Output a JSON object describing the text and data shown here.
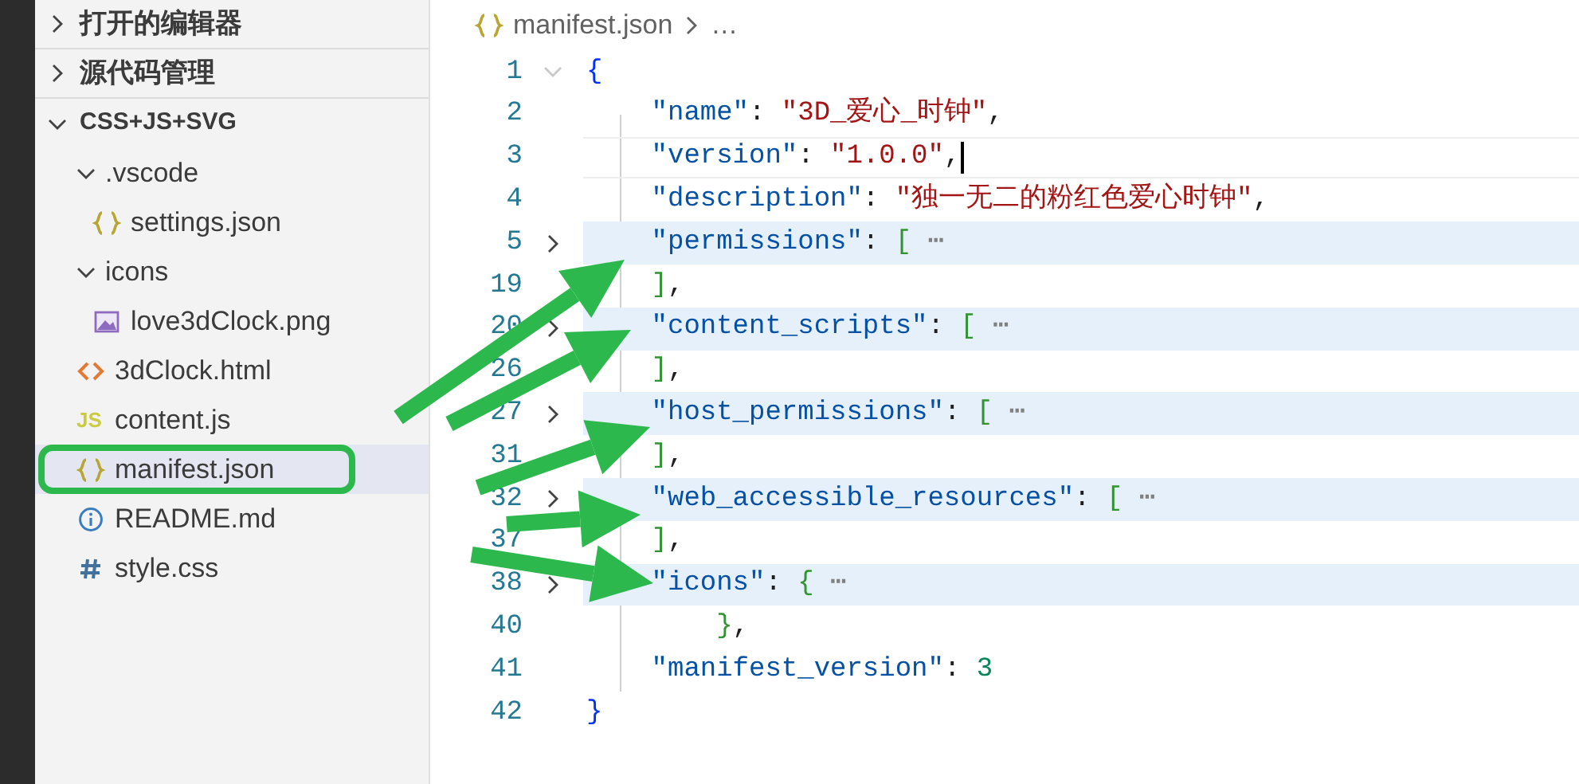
{
  "sidebar": {
    "sections": [
      {
        "label": "打开的编辑器",
        "expanded": false
      },
      {
        "label": "源代码管理",
        "expanded": false
      },
      {
        "label": "CSS+JS+SVG",
        "expanded": true,
        "children": [
          {
            "label": ".vscode",
            "kind": "folder",
            "expanded": true,
            "selected": false,
            "children": [
              {
                "label": "settings.json",
                "kind": "json",
                "selected": false
              }
            ]
          },
          {
            "label": "icons",
            "kind": "folder",
            "expanded": true,
            "selected": false,
            "children": [
              {
                "label": "love3dClock.png",
                "kind": "image",
                "selected": false
              }
            ]
          },
          {
            "label": "3dClock.html",
            "kind": "html",
            "selected": false
          },
          {
            "label": "content.js",
            "kind": "js",
            "icon_text": "JS",
            "selected": false
          },
          {
            "label": "manifest.json",
            "kind": "json",
            "selected": true
          },
          {
            "label": "README.md",
            "kind": "info",
            "selected": false
          },
          {
            "label": "style.css",
            "kind": "css",
            "selected": false
          }
        ]
      }
    ]
  },
  "breadcrumb": {
    "file": "manifest.json",
    "rest": "…"
  },
  "lines": [
    {
      "number": "1",
      "folded": false,
      "highlighted": false,
      "current": false,
      "tokens": [
        {
          "kind": "brace",
          "text": "{"
        }
      ],
      "children": [
        {
          "number": "2",
          "highlighted": false,
          "current": false,
          "tokens": [
            {
              "kind": "key",
              "text": "\"name\""
            },
            {
              "kind": "punct",
              "text": ": "
            },
            {
              "kind": "string",
              "text": "\"3D_爱心_时钟\""
            },
            {
              "kind": "punct",
              "text": ","
            }
          ]
        },
        {
          "number": "3",
          "highlighted": false,
          "current": true,
          "tokens": [
            {
              "kind": "key",
              "text": "\"version\""
            },
            {
              "kind": "punct",
              "text": ": "
            },
            {
              "kind": "string",
              "text": "\"1.0.0\""
            },
            {
              "kind": "punct",
              "text": ","
            }
          ]
        },
        {
          "number": "4",
          "highlighted": false,
          "current": false,
          "tokens": [
            {
              "kind": "key",
              "text": "\"description\""
            },
            {
              "kind": "punct",
              "text": ": "
            },
            {
              "kind": "string",
              "text": "\"独一无二的粉红色爱心时钟\""
            },
            {
              "kind": "punct",
              "text": ","
            }
          ]
        },
        {
          "number": "5",
          "folded": true,
          "highlighted": true,
          "current": false,
          "tokens": [
            {
              "kind": "key",
              "text": "\"permissions\""
            },
            {
              "kind": "punct",
              "text": ": "
            },
            {
              "kind": "bracket",
              "text": "["
            },
            {
              "kind": "ellipsis",
              "text": " ⋯"
            }
          ]
        },
        {
          "number": "19",
          "highlighted": false,
          "current": false,
          "tokens": [
            {
              "kind": "bracket",
              "text": "]"
            },
            {
              "kind": "punct",
              "text": ","
            }
          ]
        },
        {
          "number": "20",
          "folded": true,
          "highlighted": true,
          "current": false,
          "tokens": [
            {
              "kind": "key",
              "text": "\"content_scripts\""
            },
            {
              "kind": "punct",
              "text": ": "
            },
            {
              "kind": "bracket",
              "text": "["
            },
            {
              "kind": "ellipsis",
              "text": " ⋯"
            }
          ]
        },
        {
          "number": "26",
          "highlighted": false,
          "current": false,
          "tokens": [
            {
              "kind": "bracket",
              "text": "]"
            },
            {
              "kind": "punct",
              "text": ","
            }
          ]
        },
        {
          "number": "27",
          "folded": true,
          "highlighted": true,
          "current": false,
          "tokens": [
            {
              "kind": "key",
              "text": "\"host_permissions\""
            },
            {
              "kind": "punct",
              "text": ": "
            },
            {
              "kind": "bracket",
              "text": "["
            },
            {
              "kind": "ellipsis",
              "text": " ⋯"
            }
          ]
        },
        {
          "number": "31",
          "highlighted": false,
          "current": false,
          "tokens": [
            {
              "kind": "bracket",
              "text": "]"
            },
            {
              "kind": "punct",
              "text": ","
            }
          ]
        },
        {
          "number": "32",
          "folded": true,
          "highlighted": true,
          "current": false,
          "tokens": [
            {
              "kind": "key",
              "text": "\"web_accessible_resources\""
            },
            {
              "kind": "punct",
              "text": ": "
            },
            {
              "kind": "bracket",
              "text": "["
            },
            {
              "kind": "ellipsis",
              "text": " ⋯"
            }
          ]
        },
        {
          "number": "37",
          "highlighted": false,
          "current": false,
          "tokens": [
            {
              "kind": "bracket",
              "text": "]"
            },
            {
              "kind": "punct",
              "text": ","
            }
          ]
        },
        {
          "number": "38",
          "folded": true,
          "highlighted": true,
          "current": false,
          "tokens": [
            {
              "kind": "key",
              "text": "\"icons\""
            },
            {
              "kind": "punct",
              "text": ": "
            },
            {
              "kind": "bracket",
              "text": "{"
            },
            {
              "kind": "ellipsis",
              "text": " ⋯"
            }
          ],
          "children": [
            {
              "number": "40",
              "highlighted": false,
              "current": false,
              "tokens": [
                {
                  "kind": "bracket",
                  "text": "}"
                },
                {
                  "kind": "punct",
                  "text": ","
                }
              ]
            }
          ]
        },
        {
          "number": "41",
          "highlighted": false,
          "current": false,
          "tokens": [
            {
              "kind": "key",
              "text": "\"manifest_version\""
            },
            {
              "kind": "punct",
              "text": ": "
            },
            {
              "kind": "number",
              "text": "3"
            }
          ]
        }
      ]
    },
    {
      "number": "42",
      "highlighted": false,
      "current": false,
      "tokens": [
        {
          "kind": "brace",
          "text": "}"
        }
      ]
    }
  ]
}
